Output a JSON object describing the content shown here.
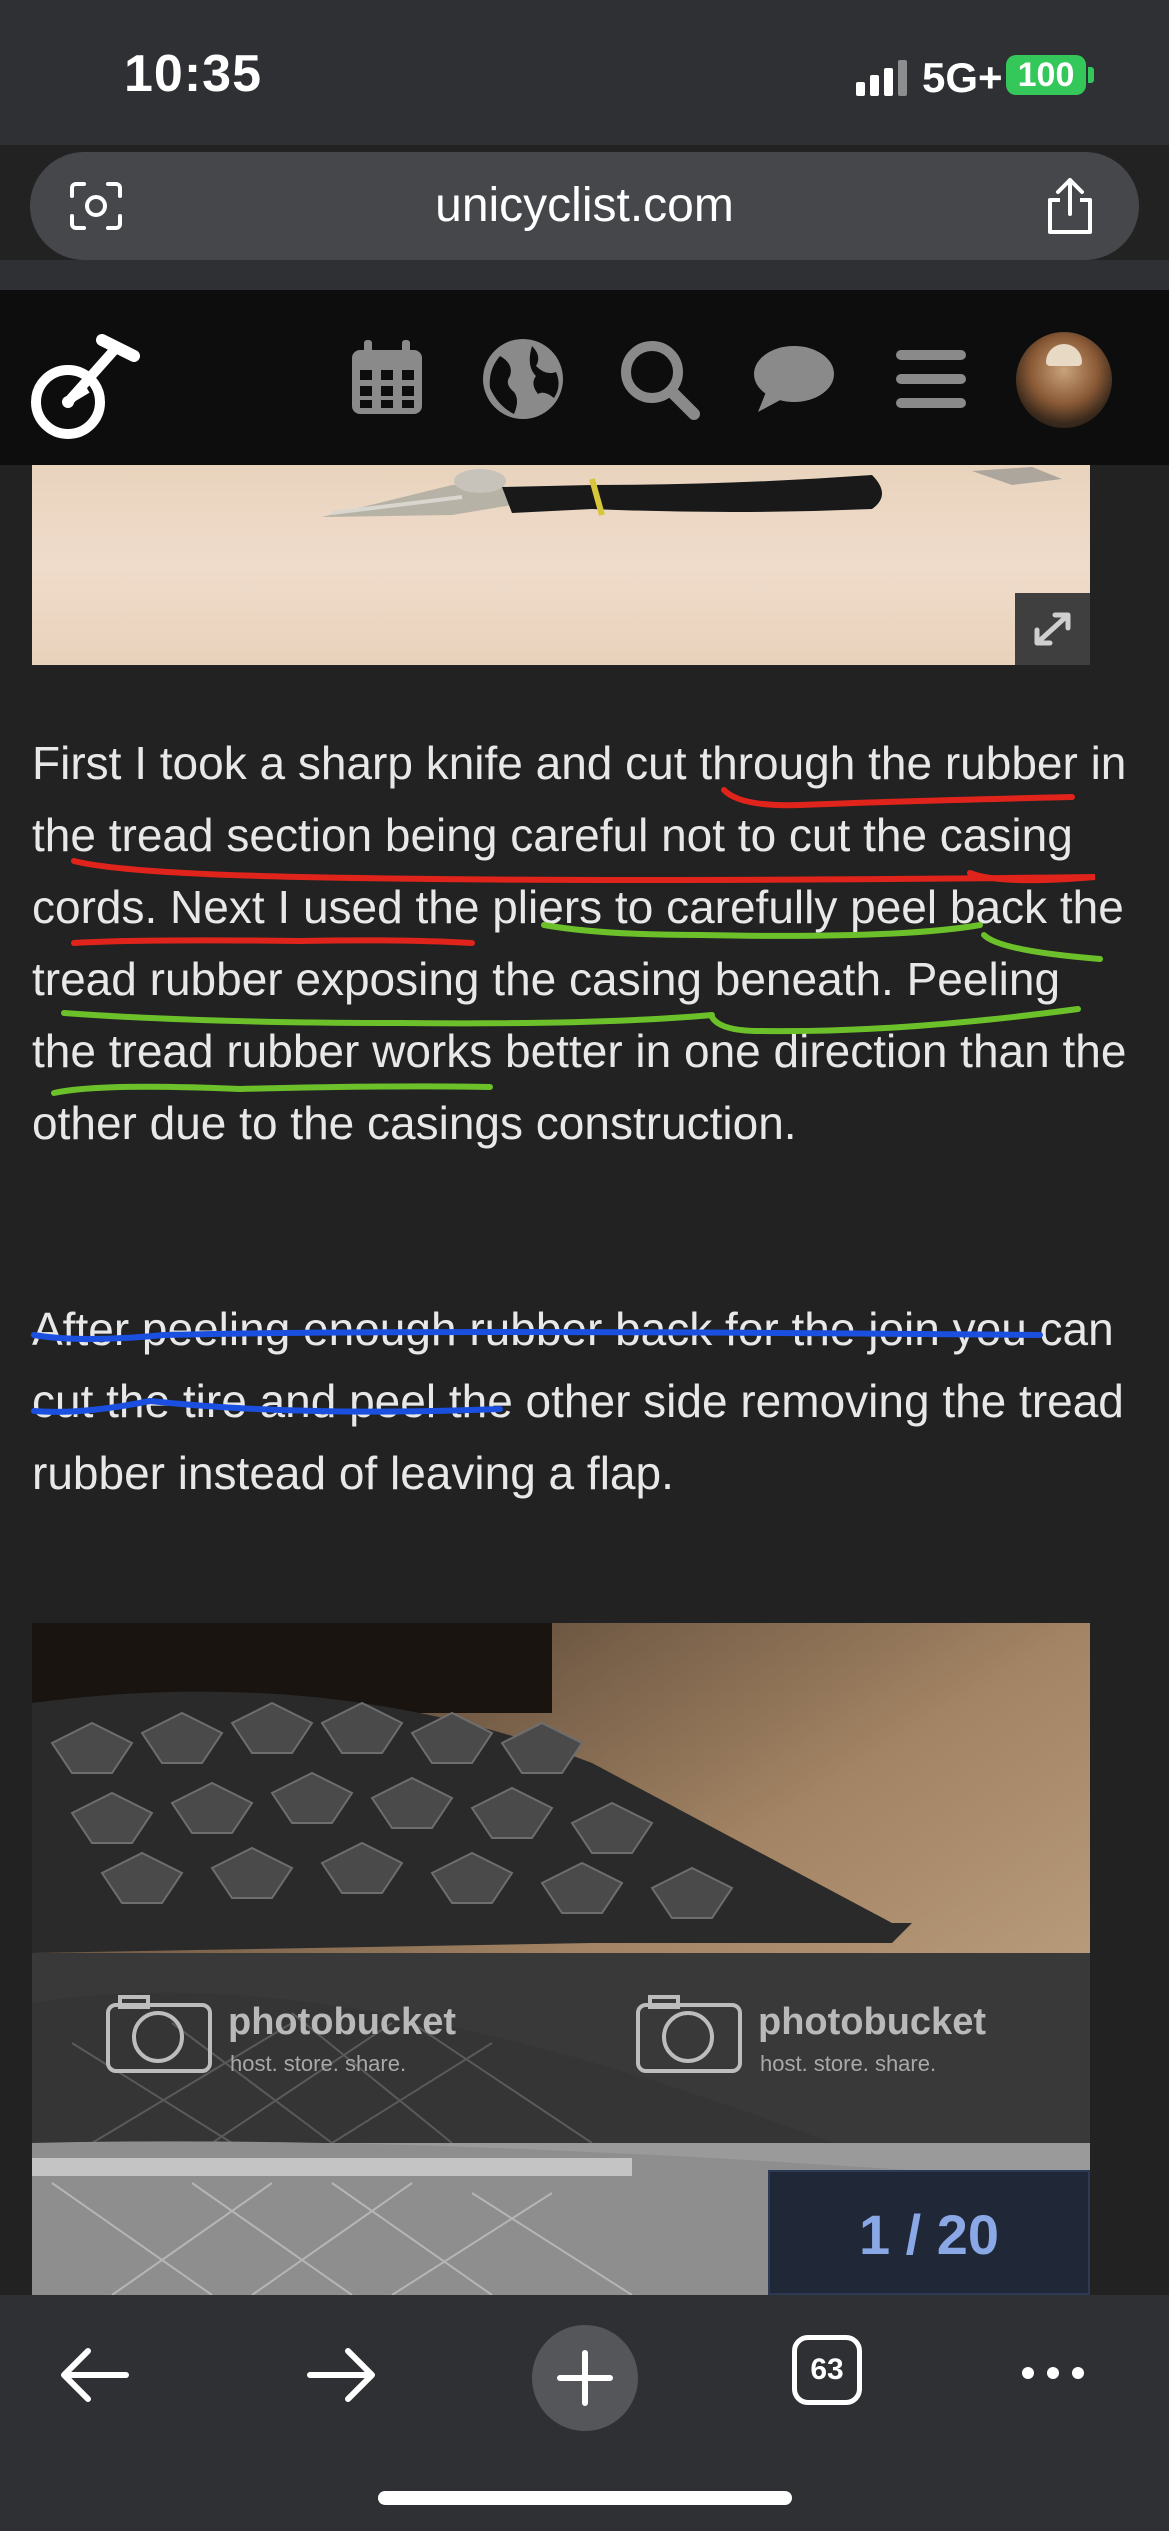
{
  "status": {
    "time": "10:35",
    "network": "5G+",
    "battery": "100"
  },
  "browser": {
    "url": "unicyclist.com"
  },
  "site_nav": {
    "icons": [
      "calendar-icon",
      "globe-icon",
      "search-icon",
      "chat-icon",
      "menu-icon"
    ]
  },
  "article": {
    "paragraph1": "First I took a sharp knife and cut through the rubber in the tread section being careful not to cut the casing cords. Next I used the pliers to carefully peel back the tread rubber exposing the casing beneath. Peeling the tread rubber works better in one direction than the other due to the casings construction.",
    "paragraph2": "After peeling enough rubber back for the join you can cut the tire and peel the other side removing the tread rubber instead of leaving a flap.",
    "watermark": {
      "brand": "photobucket",
      "tagline": "host. store. share."
    },
    "gallery_counter": "1 / 20",
    "annotation_colors": {
      "red": "#e0241b",
      "green": "#6cc12a",
      "blue": "#1a4fe0"
    }
  },
  "toolbar": {
    "tabs_count": "63"
  }
}
